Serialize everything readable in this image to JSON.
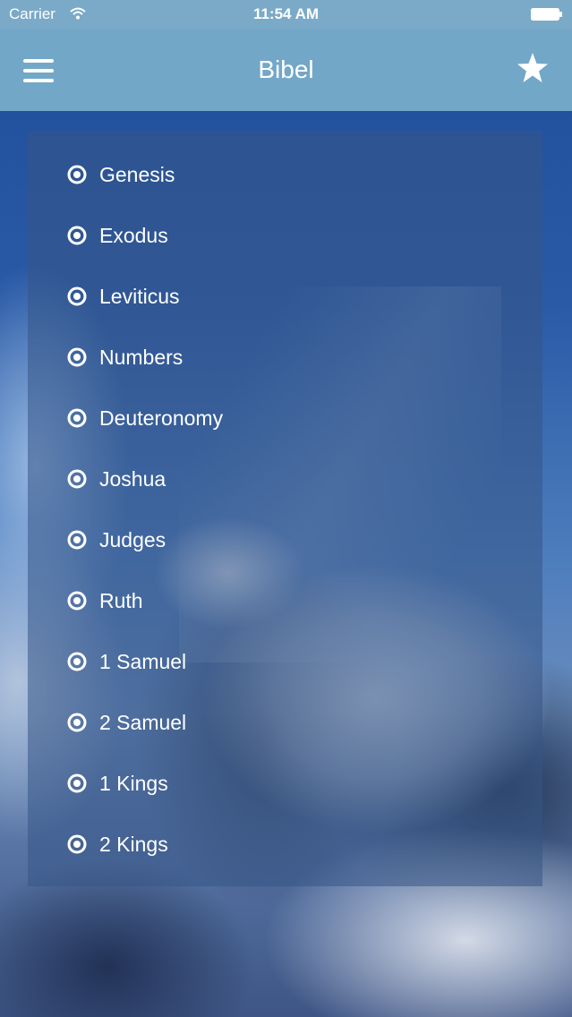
{
  "status_bar": {
    "carrier": "Carrier",
    "time": "11:54 AM",
    "icons": [
      "wifi-icon",
      "battery-icon"
    ]
  },
  "nav_bar": {
    "title": "Bibel",
    "left_icon": "hamburger-menu-icon",
    "right_icon": "star-icon",
    "color": "#73a7c8"
  },
  "book_list": {
    "item_icon": "radio-dot-icon",
    "items": [
      {
        "label": "Genesis"
      },
      {
        "label": "Exodus"
      },
      {
        "label": "Leviticus"
      },
      {
        "label": "Numbers"
      },
      {
        "label": "Deuteronomy"
      },
      {
        "label": "Joshua"
      },
      {
        "label": "Judges"
      },
      {
        "label": "Ruth"
      },
      {
        "label": "1 Samuel"
      },
      {
        "label": "2 Samuel"
      },
      {
        "label": "1 Kings"
      },
      {
        "label": "2 Kings"
      }
    ]
  }
}
